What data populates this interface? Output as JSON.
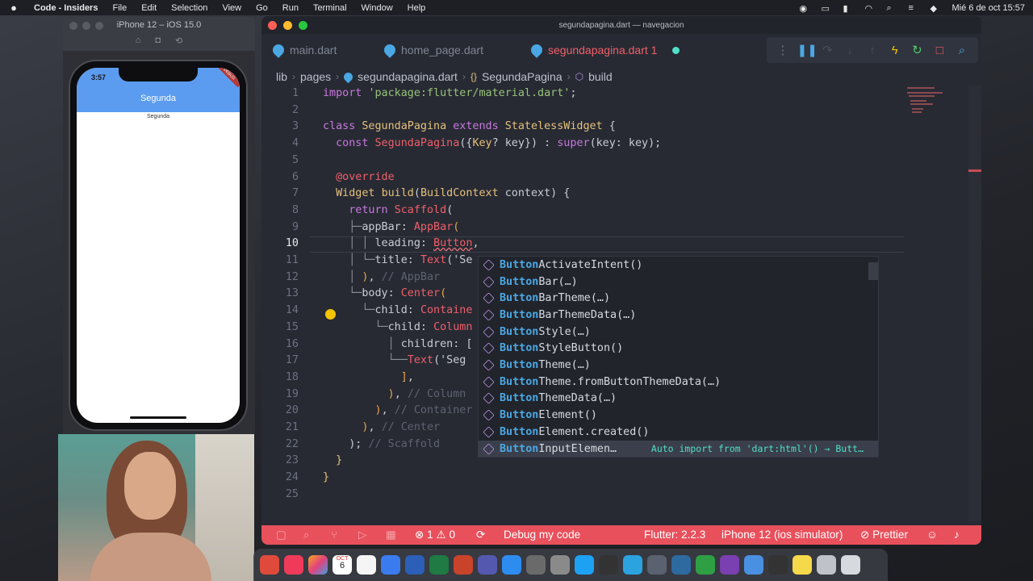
{
  "menubar": {
    "app": "Code - Insiders",
    "items": [
      "File",
      "Edit",
      "Selection",
      "View",
      "Go",
      "Run",
      "Terminal",
      "Window",
      "Help"
    ],
    "clock": "Mié 6 de oct  15:57"
  },
  "simulator": {
    "title": "iPhone 12 – iOS 15.0",
    "time": "3:57",
    "debug_badge": "DEBUG",
    "appbar_title": "Segunda",
    "body_text": "Segunda"
  },
  "vscode": {
    "window_title": "segundapagina.dart — navegacion",
    "tabs": [
      {
        "label": "main.dart",
        "active": false
      },
      {
        "label": "home_page.dart",
        "active": false
      },
      {
        "label": "segundapagina.dart 1",
        "active": true
      }
    ],
    "breadcrumbs": [
      "lib",
      "pages",
      "segundapagina.dart",
      "SegundaPagina",
      "build"
    ],
    "line_numbers": [
      "1",
      "2",
      "3",
      "4",
      "5",
      "6",
      "7",
      "8",
      "9",
      "10",
      "11",
      "12",
      "13",
      "14",
      "15",
      "16",
      "17",
      "18",
      "19",
      "20",
      "21",
      "22",
      "23",
      "24",
      "25"
    ],
    "current_line": "10",
    "suggestions": [
      {
        "match": "Button",
        "rest": "ActivateIntent()",
        "detail": ""
      },
      {
        "match": "Button",
        "rest": "Bar(…)",
        "detail": ""
      },
      {
        "match": "Button",
        "rest": "BarTheme(…)",
        "detail": ""
      },
      {
        "match": "Button",
        "rest": "BarThemeData(…)",
        "detail": ""
      },
      {
        "match": "Button",
        "rest": "Style(…)",
        "detail": ""
      },
      {
        "match": "Button",
        "rest": "StyleButton()",
        "detail": ""
      },
      {
        "match": "Button",
        "rest": "Theme(…)",
        "detail": ""
      },
      {
        "match": "Button",
        "rest": "Theme.fromButtonThemeData(…)",
        "detail": ""
      },
      {
        "match": "Button",
        "rest": "ThemeData(…)",
        "detail": ""
      },
      {
        "match": "Button",
        "rest": "Element()",
        "detail": ""
      },
      {
        "match": "Button",
        "rest": "Element.created()",
        "detail": ""
      },
      {
        "match": "Button",
        "rest": "InputElemen…",
        "detail": "Auto import from 'dart:html'() → Butt…"
      }
    ],
    "status": {
      "errors": "1",
      "warnings": "0",
      "debug": "Debug my code",
      "flutter": "Flutter: 2.2.3",
      "device": "iPhone 12 (ios simulator)",
      "prettier": "Prettier"
    }
  },
  "dock": {
    "calendar_month": "OCT",
    "calendar_day": "6"
  }
}
